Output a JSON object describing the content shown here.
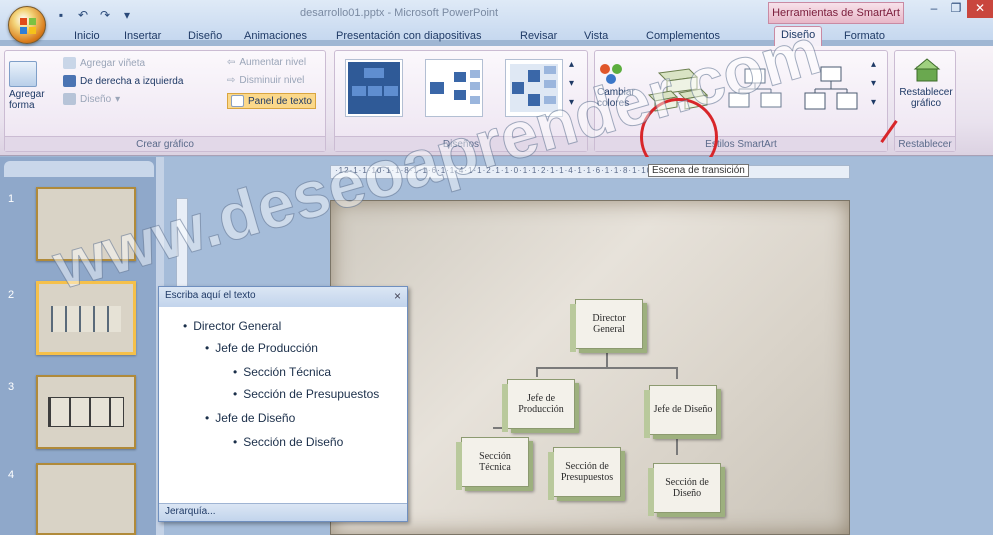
{
  "window": {
    "title": "desarrollo01.pptx - Microsoft PowerPoint",
    "tools_title": "Herramientas de SmartArt"
  },
  "tabs": [
    {
      "label": "Inicio"
    },
    {
      "label": "Insertar"
    },
    {
      "label": "Diseño"
    },
    {
      "label": "Animaciones"
    },
    {
      "label": "Presentación con diapositivas"
    },
    {
      "label": "Revisar"
    },
    {
      "label": "Vista"
    },
    {
      "label": "Complementos"
    },
    {
      "label": "Diseño",
      "active": true
    },
    {
      "label": "Formato"
    }
  ],
  "ribbon": {
    "create_graphic": {
      "label": "Crear gráfico",
      "add_shape": "Agregar forma",
      "add_bullet": "Agregar viñeta",
      "right_to_left": "De derecha a izquierda",
      "design": "Diseño",
      "promote": "Aumentar nivel",
      "demote": "Disminuir nivel",
      "text_pane": "Panel de texto"
    },
    "layouts": {
      "label": "Diseños"
    },
    "smartart_styles": {
      "label": "Estilos SmartArt",
      "change_colors": "Cambiar colores"
    },
    "reset": {
      "label": "Restablecer",
      "reset_graphic": "Restablecer gráfico"
    }
  },
  "ruler": {
    "text": "·12·1·1·10·1·1·8·1·1·6·1·1·4·1·1·2·1·1·0·1·1·2·1·1·4·1·1·6·1·1·8·1·10",
    "tooltip": "Escena de transición"
  },
  "slides": [
    {
      "number": "1"
    },
    {
      "number": "2"
    },
    {
      "number": "3"
    },
    {
      "number": "4"
    }
  ],
  "text_pane": {
    "title": "Escriba aquí el texto",
    "close": "×",
    "items": [
      {
        "text": "Director General",
        "level": 1
      },
      {
        "text": "Jefe de Producción",
        "level": 2
      },
      {
        "text": "Sección Técnica",
        "level": 3
      },
      {
        "text": "Sección de Presupuestos",
        "level": 3
      },
      {
        "text": "Jefe de Diseño",
        "level": 2
      },
      {
        "text": "Sección de Diseño",
        "level": 3
      }
    ],
    "footer": "Jerarquía..."
  },
  "org_chart": {
    "director": "Director General",
    "production_head": "Jefe de Producción",
    "design_head": "Jefe de Diseño",
    "technical": "Sección Técnica",
    "budget": "Sección de Presupuestos",
    "design": "Sección de Diseño"
  },
  "watermark": "www.deseoaprender.com",
  "colors": {
    "ribbon_bg": "#f8f3f8",
    "tools_tab": "#e8b7c8",
    "highlight": "#f5c04a",
    "annotation_red": "#d8262a"
  }
}
